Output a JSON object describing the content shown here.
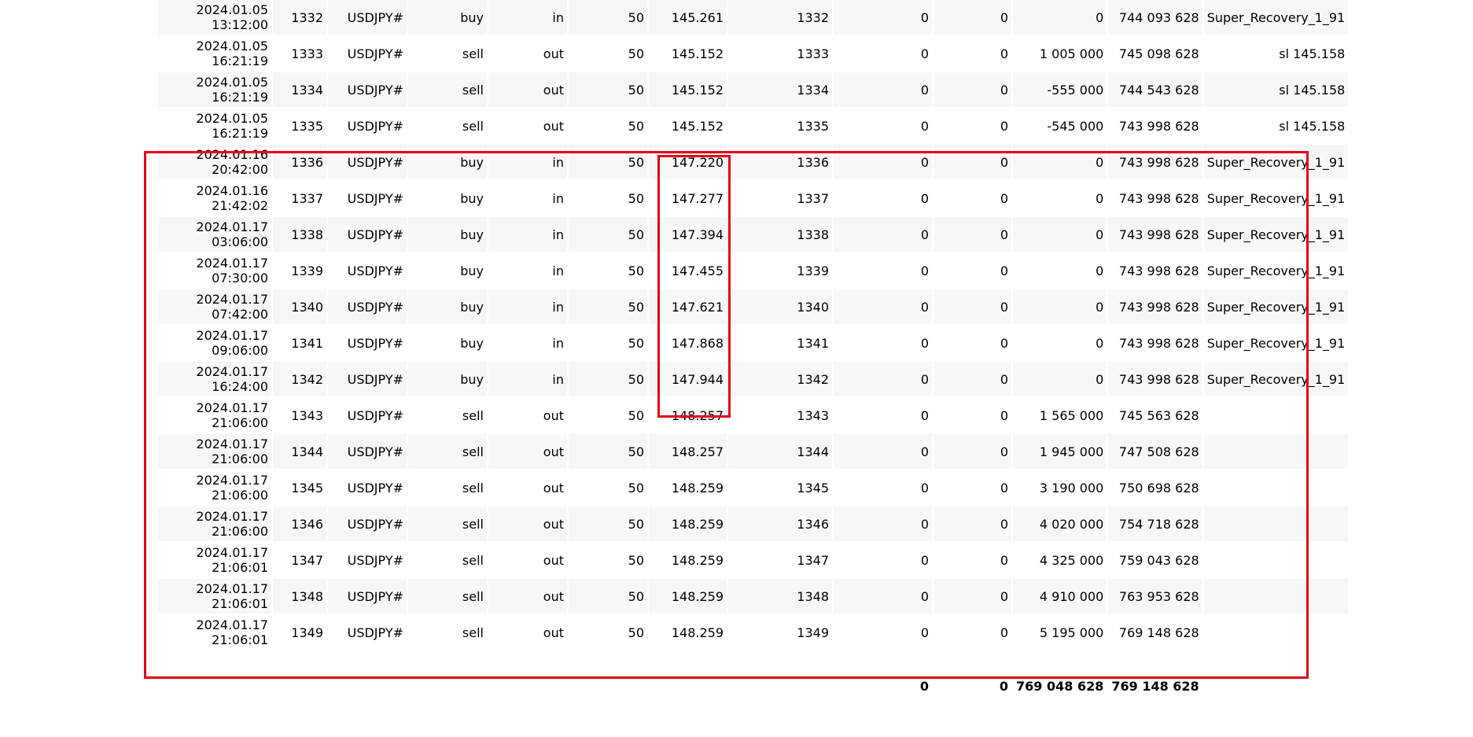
{
  "rows": [
    {
      "time_date": "2024.01.05",
      "time_clock": "13:12:00",
      "deal": "1332",
      "symbol": "USDJPY#",
      "type": "buy",
      "direction": "in",
      "volume": "50",
      "price": "145.261",
      "order": "1332",
      "commission": "0",
      "swap": "0",
      "profit": "0",
      "balance": "744 093 628",
      "comment": "Super_Recovery_1_91"
    },
    {
      "time_date": "2024.01.05",
      "time_clock": "16:21:19",
      "deal": "1333",
      "symbol": "USDJPY#",
      "type": "sell",
      "direction": "out",
      "volume": "50",
      "price": "145.152",
      "order": "1333",
      "commission": "0",
      "swap": "0",
      "profit": "1 005 000",
      "balance": "745 098 628",
      "comment": "sl 145.158"
    },
    {
      "time_date": "2024.01.05",
      "time_clock": "16:21:19",
      "deal": "1334",
      "symbol": "USDJPY#",
      "type": "sell",
      "direction": "out",
      "volume": "50",
      "price": "145.152",
      "order": "1334",
      "commission": "0",
      "swap": "0",
      "profit": "-555 000",
      "balance": "744 543 628",
      "comment": "sl 145.158"
    },
    {
      "time_date": "2024.01.05",
      "time_clock": "16:21:19",
      "deal": "1335",
      "symbol": "USDJPY#",
      "type": "sell",
      "direction": "out",
      "volume": "50",
      "price": "145.152",
      "order": "1335",
      "commission": "0",
      "swap": "0",
      "profit": "-545 000",
      "balance": "743 998 628",
      "comment": "sl 145.158"
    },
    {
      "time_date": "2024.01.16",
      "time_clock": "20:42:00",
      "deal": "1336",
      "symbol": "USDJPY#",
      "type": "buy",
      "direction": "in",
      "volume": "50",
      "price": "147.220",
      "order": "1336",
      "commission": "0",
      "swap": "0",
      "profit": "0",
      "balance": "743 998 628",
      "comment": "Super_Recovery_1_91"
    },
    {
      "time_date": "2024.01.16",
      "time_clock": "21:42:02",
      "deal": "1337",
      "symbol": "USDJPY#",
      "type": "buy",
      "direction": "in",
      "volume": "50",
      "price": "147.277",
      "order": "1337",
      "commission": "0",
      "swap": "0",
      "profit": "0",
      "balance": "743 998 628",
      "comment": "Super_Recovery_1_91"
    },
    {
      "time_date": "2024.01.17",
      "time_clock": "03:06:00",
      "deal": "1338",
      "symbol": "USDJPY#",
      "type": "buy",
      "direction": "in",
      "volume": "50",
      "price": "147.394",
      "order": "1338",
      "commission": "0",
      "swap": "0",
      "profit": "0",
      "balance": "743 998 628",
      "comment": "Super_Recovery_1_91"
    },
    {
      "time_date": "2024.01.17",
      "time_clock": "07:30:00",
      "deal": "1339",
      "symbol": "USDJPY#",
      "type": "buy",
      "direction": "in",
      "volume": "50",
      "price": "147.455",
      "order": "1339",
      "commission": "0",
      "swap": "0",
      "profit": "0",
      "balance": "743 998 628",
      "comment": "Super_Recovery_1_91"
    },
    {
      "time_date": "2024.01.17",
      "time_clock": "07:42:00",
      "deal": "1340",
      "symbol": "USDJPY#",
      "type": "buy",
      "direction": "in",
      "volume": "50",
      "price": "147.621",
      "order": "1340",
      "commission": "0",
      "swap": "0",
      "profit": "0",
      "balance": "743 998 628",
      "comment": "Super_Recovery_1_91"
    },
    {
      "time_date": "2024.01.17",
      "time_clock": "09:06:00",
      "deal": "1341",
      "symbol": "USDJPY#",
      "type": "buy",
      "direction": "in",
      "volume": "50",
      "price": "147.868",
      "order": "1341",
      "commission": "0",
      "swap": "0",
      "profit": "0",
      "balance": "743 998 628",
      "comment": "Super_Recovery_1_91"
    },
    {
      "time_date": "2024.01.17",
      "time_clock": "16:24:00",
      "deal": "1342",
      "symbol": "USDJPY#",
      "type": "buy",
      "direction": "in",
      "volume": "50",
      "price": "147.944",
      "order": "1342",
      "commission": "0",
      "swap": "0",
      "profit": "0",
      "balance": "743 998 628",
      "comment": "Super_Recovery_1_91"
    },
    {
      "time_date": "2024.01.17",
      "time_clock": "21:06:00",
      "deal": "1343",
      "symbol": "USDJPY#",
      "type": "sell",
      "direction": "out",
      "volume": "50",
      "price": "148.257",
      "order": "1343",
      "commission": "0",
      "swap": "0",
      "profit": "1 565 000",
      "balance": "745 563 628",
      "comment": ""
    },
    {
      "time_date": "2024.01.17",
      "time_clock": "21:06:00",
      "deal": "1344",
      "symbol": "USDJPY#",
      "type": "sell",
      "direction": "out",
      "volume": "50",
      "price": "148.257",
      "order": "1344",
      "commission": "0",
      "swap": "0",
      "profit": "1 945 000",
      "balance": "747 508 628",
      "comment": ""
    },
    {
      "time_date": "2024.01.17",
      "time_clock": "21:06:00",
      "deal": "1345",
      "symbol": "USDJPY#",
      "type": "sell",
      "direction": "out",
      "volume": "50",
      "price": "148.259",
      "order": "1345",
      "commission": "0",
      "swap": "0",
      "profit": "3 190 000",
      "balance": "750 698 628",
      "comment": ""
    },
    {
      "time_date": "2024.01.17",
      "time_clock": "21:06:00",
      "deal": "1346",
      "symbol": "USDJPY#",
      "type": "sell",
      "direction": "out",
      "volume": "50",
      "price": "148.259",
      "order": "1346",
      "commission": "0",
      "swap": "0",
      "profit": "4 020 000",
      "balance": "754 718 628",
      "comment": ""
    },
    {
      "time_date": "2024.01.17",
      "time_clock": "21:06:01",
      "deal": "1347",
      "symbol": "USDJPY#",
      "type": "sell",
      "direction": "out",
      "volume": "50",
      "price": "148.259",
      "order": "1347",
      "commission": "0",
      "swap": "0",
      "profit": "4 325 000",
      "balance": "759 043 628",
      "comment": ""
    },
    {
      "time_date": "2024.01.17",
      "time_clock": "21:06:01",
      "deal": "1348",
      "symbol": "USDJPY#",
      "type": "sell",
      "direction": "out",
      "volume": "50",
      "price": "148.259",
      "order": "1348",
      "commission": "0",
      "swap": "0",
      "profit": "4 910 000",
      "balance": "763 953 628",
      "comment": ""
    },
    {
      "time_date": "2024.01.17",
      "time_clock": "21:06:01",
      "deal": "1349",
      "symbol": "USDJPY#",
      "type": "sell",
      "direction": "out",
      "volume": "50",
      "price": "148.259",
      "order": "1349",
      "commission": "0",
      "swap": "0",
      "profit": "5 195 000",
      "balance": "769 148 628",
      "comment": ""
    }
  ],
  "totals": {
    "commission": "0",
    "swap": "0",
    "profit": "769 048 628",
    "balance": "769 148 628"
  },
  "colors": {
    "highlight": "#e3001b",
    "row_alt": "#f7f7f7"
  }
}
